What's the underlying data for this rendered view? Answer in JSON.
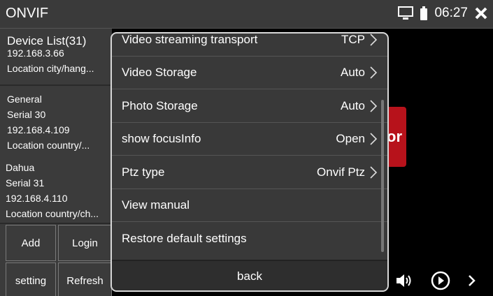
{
  "app": {
    "title": "ONVIF",
    "time": "06:27"
  },
  "device_list": {
    "header": "Device List(31)",
    "devices": [
      {
        "lines": [
          "192.168.3.66",
          "Location city/hang..."
        ]
      },
      {
        "lines": [
          "General",
          "Serial 30",
          "192.168.4.109",
          "Location country/..."
        ]
      },
      {
        "lines": [
          "Dahua",
          "Serial 31",
          "192.168.4.110",
          "Location country/ch..."
        ]
      }
    ],
    "buttons": {
      "add": "Add",
      "login": "Login",
      "setting": "setting",
      "refresh": "Refresh"
    }
  },
  "background": {
    "partial_text": "or"
  },
  "menu": {
    "items": [
      {
        "label": "Video streaming transport",
        "value": "TCP"
      },
      {
        "label": "Video Storage",
        "value": "Auto"
      },
      {
        "label": "Photo Storage",
        "value": "Auto"
      },
      {
        "label": "show focusInfo",
        "value": "Open"
      },
      {
        "label": "Ptz type",
        "value": "Onvif Ptz"
      },
      {
        "label": "View manual",
        "value": ""
      },
      {
        "label": "Restore default settings",
        "value": ""
      }
    ],
    "back": "back"
  },
  "icons": {
    "status": [
      "monitor-icon",
      "battery-icon",
      "close-icon"
    ],
    "controls": [
      "volume-icon",
      "play-circle-icon",
      "chevron-right-icon"
    ]
  }
}
